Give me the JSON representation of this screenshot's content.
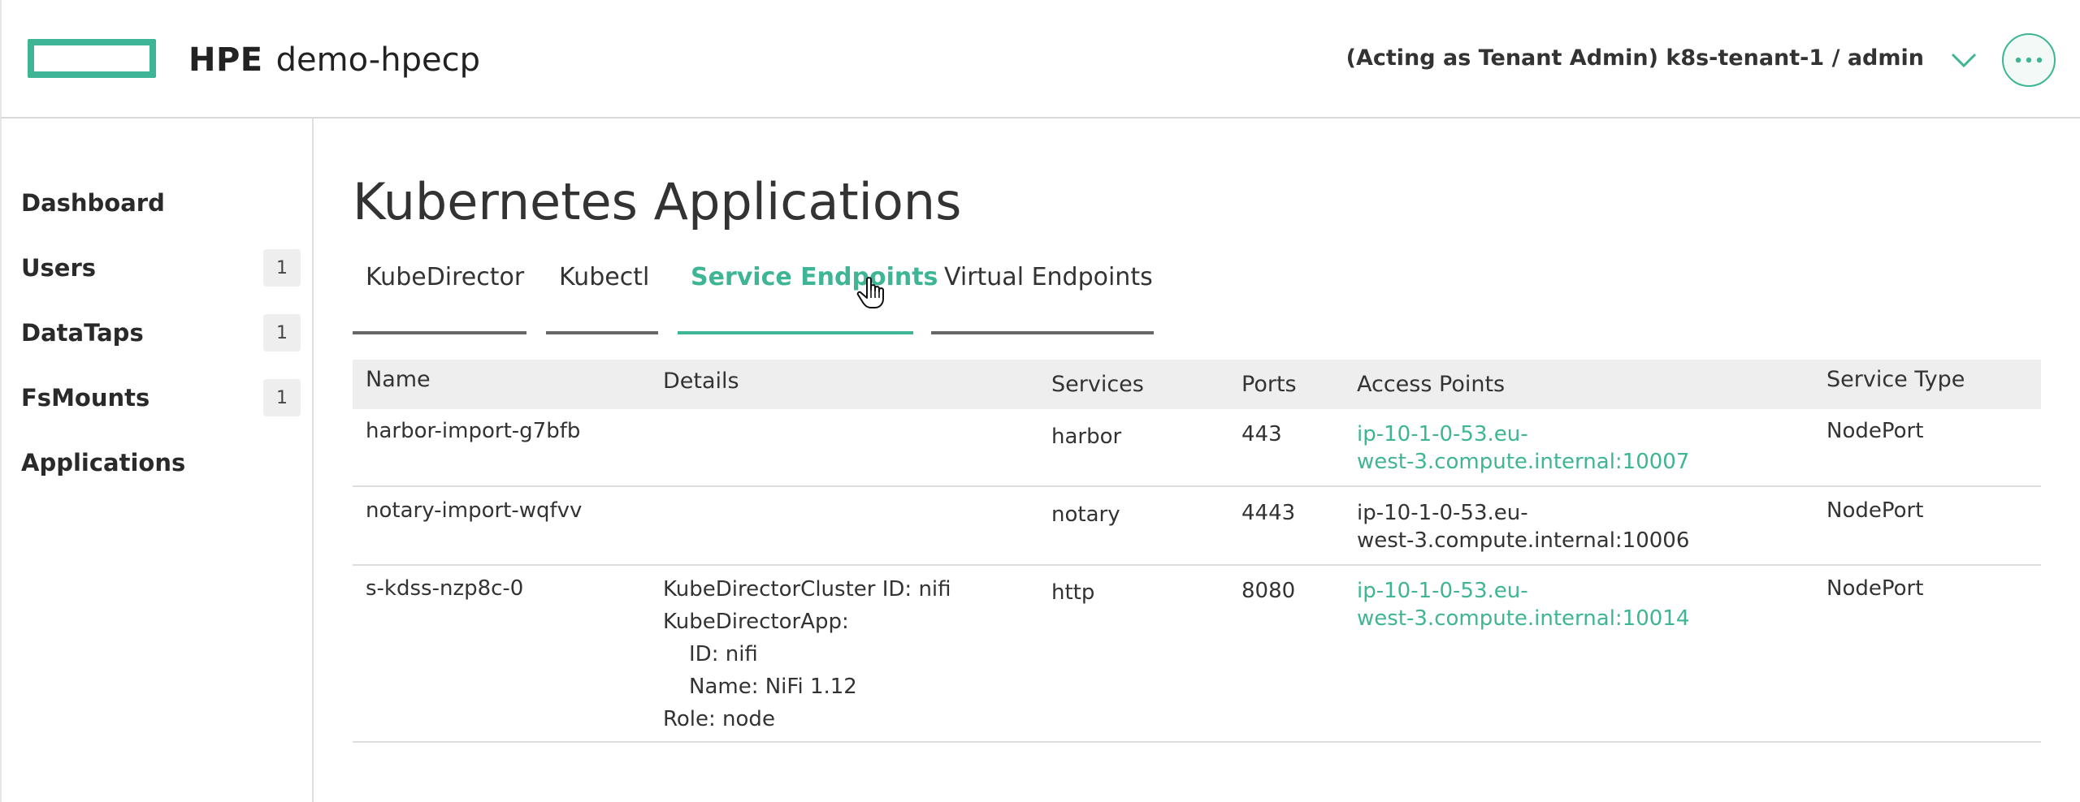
{
  "header": {
    "brand": "HPE",
    "app_name": "demo-hpecp",
    "acting_as": "(Acting as Tenant Admin) k8s-tenant-1 / admin",
    "menu_icon": "chevron-down-icon",
    "more_icon": "more-horizontal-icon"
  },
  "colors": {
    "accent": "#3eb594",
    "text": "#333333",
    "table_header_bg": "#eeeeee"
  },
  "sidebar": {
    "items": [
      {
        "label": "Dashboard",
        "badge": ""
      },
      {
        "label": "Users",
        "badge": "1"
      },
      {
        "label": "DataTaps",
        "badge": "1"
      },
      {
        "label": "FsMounts",
        "badge": "1"
      },
      {
        "label": "Applications",
        "badge": ""
      }
    ]
  },
  "main": {
    "title": "Kubernetes Applications",
    "tabs": [
      {
        "label": "KubeDirector"
      },
      {
        "label": "Kubectl"
      },
      {
        "label": "Service Endpoints"
      },
      {
        "label": "Virtual Endpoints"
      }
    ],
    "active_tab": "Service Endpoints",
    "table": {
      "columns": [
        "Name",
        "Details",
        "Services",
        "Ports",
        "Access Points",
        "Service Type"
      ],
      "rows": [
        {
          "name": "harbor-import-g7bfb",
          "details": [],
          "services": "harbor",
          "ports": "443",
          "access_point_1": "ip-10-1-0-53.eu-",
          "access_point_2": "west-3.compute.internal:10007",
          "access_link": true,
          "service_type": "NodePort"
        },
        {
          "name": "notary-import-wqfvv",
          "details": [],
          "services": "notary",
          "ports": "4443",
          "access_point_1": "ip-10-1-0-53.eu-",
          "access_point_2": "west-3.compute.internal:10006",
          "access_link": false,
          "service_type": "NodePort"
        },
        {
          "name": "s-kdss-nzp8c-0",
          "details": [
            "KubeDirectorCluster ID: nifi",
            "KubeDirectorApp:",
            "ID: nifi",
            "Name: NiFi 1.12",
            "Role: node"
          ],
          "services": "http",
          "ports": "8080",
          "access_point_1": "ip-10-1-0-53.eu-",
          "access_point_2": "west-3.compute.internal:10014",
          "access_link": true,
          "service_type": "NodePort"
        }
      ]
    }
  }
}
